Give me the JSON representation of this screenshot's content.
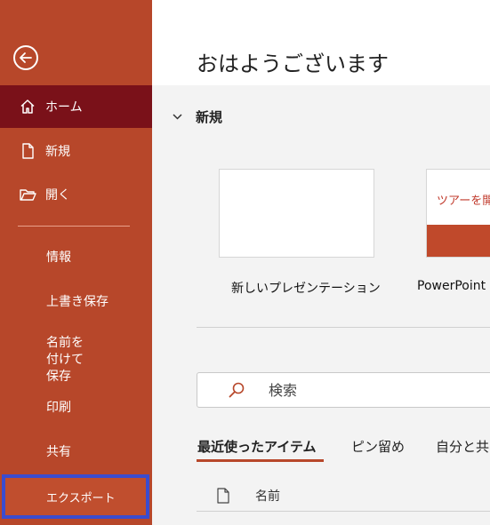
{
  "sidebar": {
    "items": [
      {
        "label": "ホーム",
        "icon": "home-icon",
        "active": true
      },
      {
        "label": "新規",
        "icon": "new-file-icon"
      },
      {
        "label": "開く",
        "icon": "open-folder-icon"
      },
      {
        "label": "情報"
      },
      {
        "label": "上書き保存"
      },
      {
        "label": "名前を付けて保存"
      },
      {
        "label": "印刷"
      },
      {
        "label": "共有"
      },
      {
        "label": "エクスポート",
        "highlighted": true
      }
    ]
  },
  "main": {
    "greeting": "おはようございます",
    "new_section": {
      "title": "新規",
      "templates": [
        {
          "label": "新しいプレゼンテーション"
        },
        {
          "label": "PowerPoint",
          "preview_text": "ツアーを開"
        }
      ]
    },
    "search": {
      "placeholder": "検索"
    },
    "tabs": [
      {
        "label": "最近使ったアイテム",
        "active": true
      },
      {
        "label": "ピン留め"
      },
      {
        "label": "自分と共"
      }
    ],
    "file_list": {
      "column_name": "名前"
    }
  },
  "colors": {
    "sidebar": "#b7472a",
    "active": "#7a1119",
    "highlight_border": "#3b4ccf"
  }
}
